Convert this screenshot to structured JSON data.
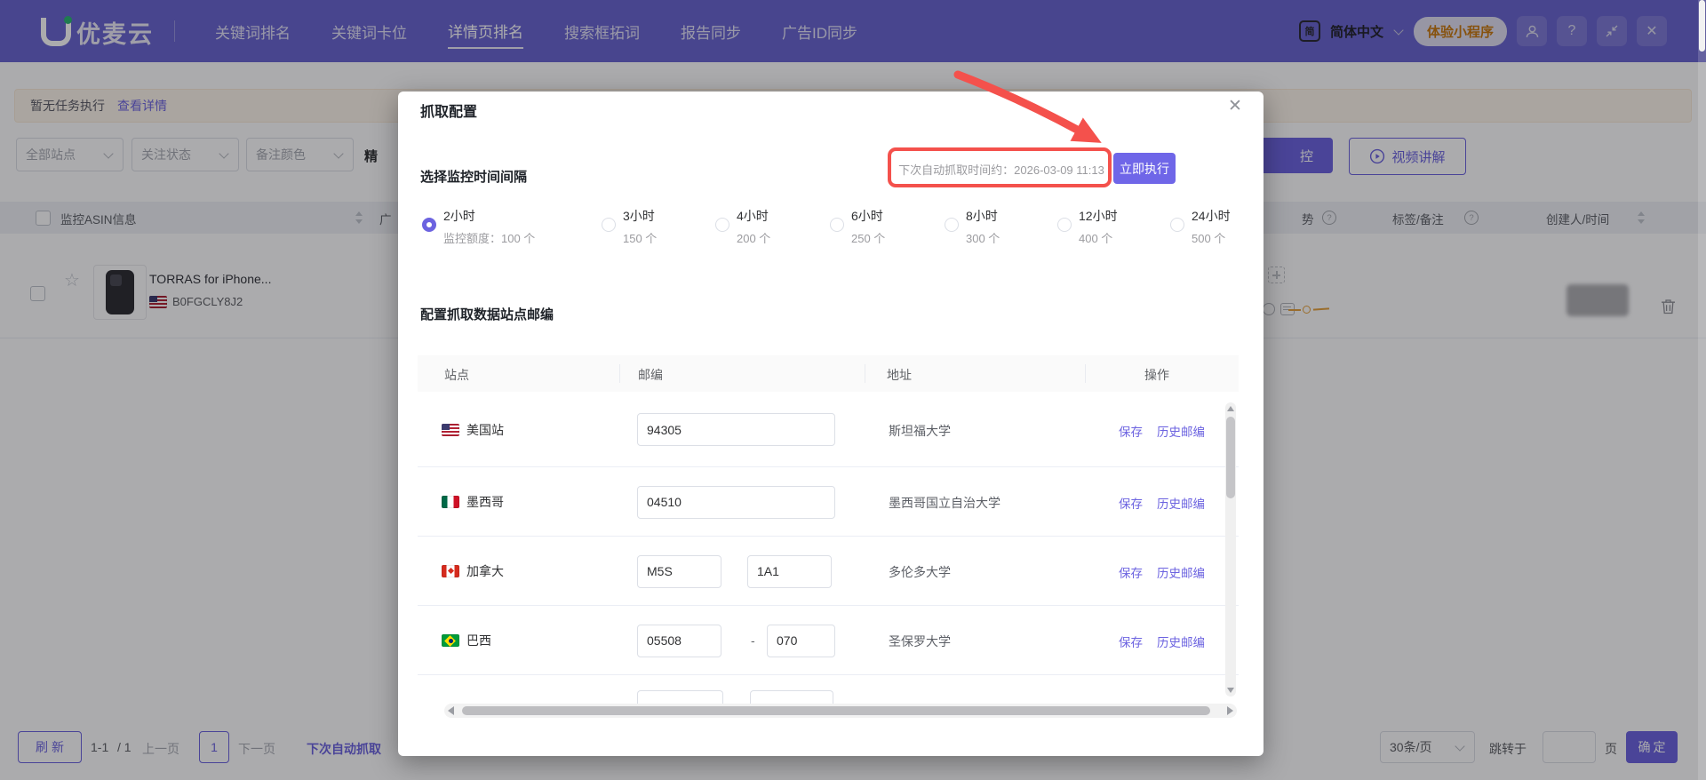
{
  "glyphs": {
    "question": "?",
    "close": "✕",
    "star": "☆"
  },
  "colors": {
    "accent": "#6C63E0",
    "annotation_red": "#F4514C",
    "trend_yellow": "#E6A23C",
    "header_purple": "#6A65D0",
    "pill_orange": "#C8790F"
  },
  "header": {
    "logo_text": "优麦云",
    "nav": [
      {
        "label": "关键词排名",
        "active": false
      },
      {
        "label": "关键词卡位",
        "active": false
      },
      {
        "label": "详情页排名",
        "active": true
      },
      {
        "label": "搜索框拓词",
        "active": false
      },
      {
        "label": "报告同步",
        "active": false
      },
      {
        "label": "广告ID同步",
        "active": false
      }
    ],
    "language_badge": "简",
    "language": "简体中文",
    "mini_program_pill": "体验小程序"
  },
  "notice_bar": {
    "text": "暂无任务执行",
    "link": "查看详情"
  },
  "filters": {
    "dropdowns": [
      "全部站点",
      "关注状态",
      "备注颜色"
    ],
    "partial_label": "精",
    "monitor_button_partial": "控",
    "video_button": "视频讲解"
  },
  "asin_table": {
    "header_asin": "监控ASIN信息",
    "header_ad_partial": "广",
    "header_trend_partial": "势",
    "header_tag": "标签/备注",
    "header_creator": "创建人/时间",
    "row": {
      "title": "TORRAS for iPhone...",
      "asin": "B0FGCLY8J2",
      "flag": "us"
    }
  },
  "pagination": {
    "refresh": "刷新",
    "range": "1-1",
    "total": "/ 1",
    "prev": "上一页",
    "current": "1",
    "next": "下一页",
    "next_crawl_partial": "下次自动抓取",
    "page_size": "30条/页",
    "jump_label": "跳转于",
    "jump_unit": "页",
    "confirm": "确定"
  },
  "modal": {
    "title": "抓取配置",
    "interval_label": "选择监控时间间隔",
    "next_crawl_text": "下次自动抓取时间约：2026-03-09 11:13",
    "execute_button": "立即执行",
    "intervals": [
      {
        "label": "2小时",
        "quota": "监控额度：100 个",
        "selected": true
      },
      {
        "label": "3小时",
        "quota": "150 个",
        "selected": false
      },
      {
        "label": "4小时",
        "quota": "200 个",
        "selected": false
      },
      {
        "label": "6小时",
        "quota": "250 个",
        "selected": false
      },
      {
        "label": "8小时",
        "quota": "300 个",
        "selected": false
      },
      {
        "label": "12小时",
        "quota": "400 个",
        "selected": false
      },
      {
        "label": "24小时",
        "quota": "500 个",
        "selected": false
      }
    ],
    "zipcode_section_title": "配置抓取数据站点邮编",
    "zip_table": {
      "headers": [
        "站点",
        "邮编",
        "地址",
        "操作"
      ],
      "rows": [
        {
          "flag": "us",
          "site": "美国站",
          "zips": [
            "94305"
          ],
          "separator": "",
          "address": "斯坦福大学",
          "actions": [
            "保存",
            "历史邮编"
          ]
        },
        {
          "flag": "mx",
          "site": "墨西哥",
          "zips": [
            "04510"
          ],
          "separator": "",
          "address": "墨西哥国立自治大学",
          "actions": [
            "保存",
            "历史邮编"
          ]
        },
        {
          "flag": "ca",
          "site": "加拿大",
          "zips": [
            "M5S",
            "1A1"
          ],
          "separator": "",
          "address": "多伦多大学",
          "actions": [
            "保存",
            "历史邮编"
          ]
        },
        {
          "flag": "br",
          "site": "巴西",
          "zips": [
            "05508",
            "070"
          ],
          "separator": "-",
          "address": "圣保罗大学",
          "actions": [
            "保存",
            "历史邮编"
          ]
        }
      ]
    }
  }
}
